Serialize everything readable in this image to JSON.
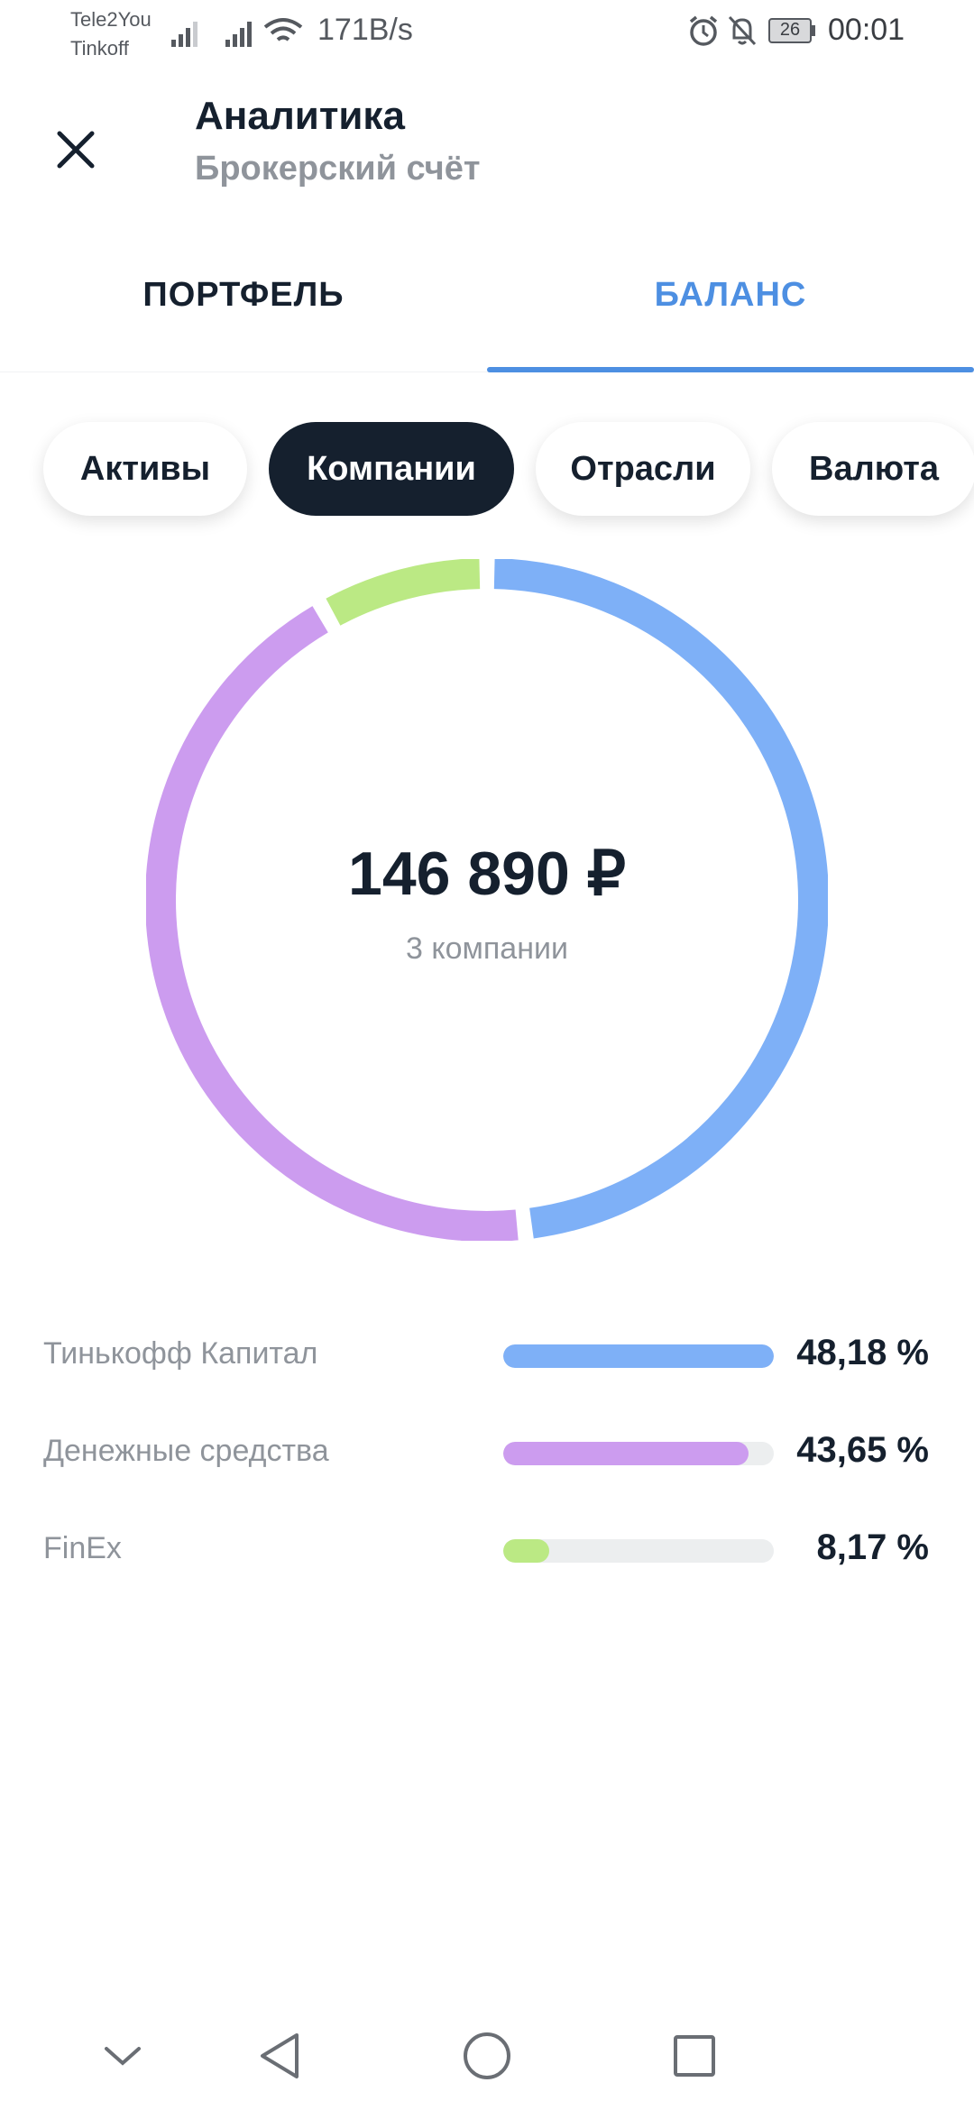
{
  "status_bar": {
    "carrier1": "Tele2You",
    "carrier2": "Tinkoff",
    "speed": "171B/s",
    "battery": "26",
    "time": "00:01"
  },
  "header": {
    "title": "Аналитика",
    "subtitle": "Брокерский счёт"
  },
  "tabs": [
    {
      "label": "ПОРТФЕЛЬ",
      "active": false
    },
    {
      "label": "БАЛАНС",
      "active": true
    }
  ],
  "chips": [
    {
      "label": "Активы",
      "active": false
    },
    {
      "label": "Компании",
      "active": true
    },
    {
      "label": "Отрасли",
      "active": false
    },
    {
      "label": "Валюта",
      "active": false
    }
  ],
  "summary": {
    "total": "146 890 ₽",
    "count": "3 компании"
  },
  "chart_data": {
    "type": "pie",
    "categories": [
      "Тинькофф Капитал",
      "Денежные средства",
      "FinEx"
    ],
    "values": [
      48.18,
      43.65,
      8.17
    ],
    "colors": [
      "#7eb0f7",
      "#cc9cef",
      "#bbe984"
    ]
  },
  "legend": [
    {
      "name": "Тинькофф Капитал",
      "percent": "48,18 %",
      "value": 0.4818,
      "bar_fill": 1.0,
      "color": "#7eb0f7"
    },
    {
      "name": "Денежные средства",
      "percent": "43,65 %",
      "value": 0.4365,
      "bar_fill": 0.906,
      "color": "#cc9cef"
    },
    {
      "name": "FinEx",
      "percent": "8,17 %",
      "value": 0.0817,
      "bar_fill": 0.17,
      "color": "#bbe984"
    }
  ],
  "icons": {
    "close": "close-icon",
    "back": "nav-back-icon",
    "home": "nav-home-icon",
    "recents": "nav-recents-icon",
    "collapse": "nav-collapse-icon"
  }
}
